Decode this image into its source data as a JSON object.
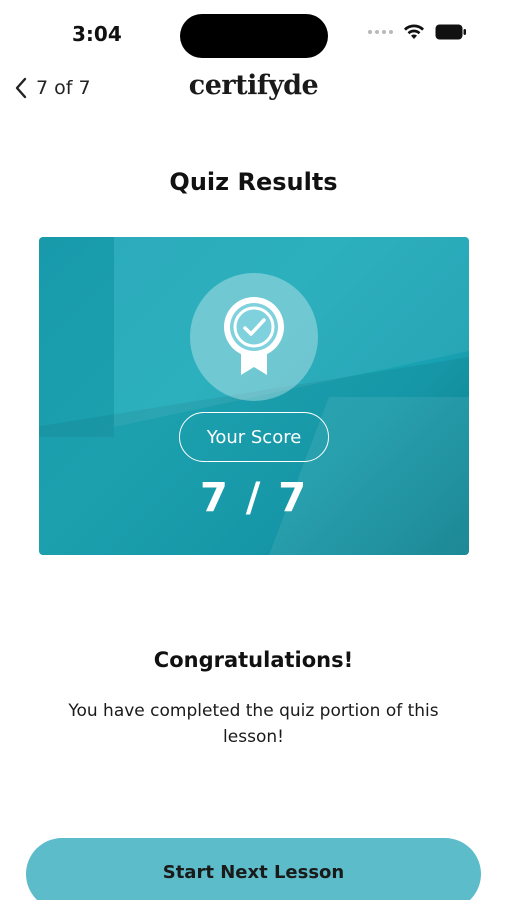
{
  "status_bar": {
    "time": "3:04"
  },
  "nav": {
    "back_label": "7 of 7",
    "brand": "certifyde"
  },
  "page": {
    "title": "Quiz Results"
  },
  "score_card": {
    "label": "Your Score",
    "score": "7 / 7"
  },
  "message": {
    "title": "Congratulations!",
    "body": "You have completed the quiz portion of this lesson!"
  },
  "actions": {
    "next_lesson": "Start Next Lesson"
  },
  "colors": {
    "card": "#1aa3b5",
    "button": "#5cbcc9"
  },
  "icons": [
    "chevron-left-icon",
    "award-ribbon-icon",
    "wifi-icon",
    "battery-icon",
    "signal-dots-icon"
  ]
}
